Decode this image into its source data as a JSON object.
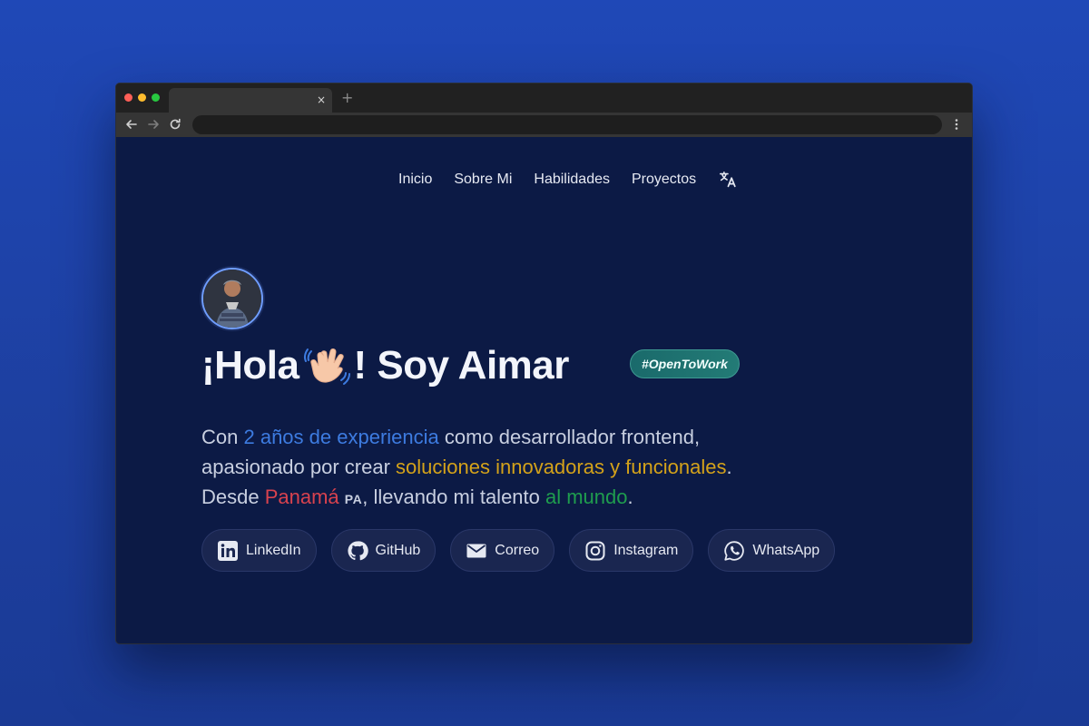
{
  "browser": {
    "tab_close": "×",
    "new_tab": "+"
  },
  "nav": {
    "items": [
      "Inicio",
      "Sobre Mi",
      "Habilidades",
      "Proyectos"
    ],
    "translate_icon": "translate-icon"
  },
  "hero": {
    "headline_start": "¡Hola",
    "headline_end": "! Soy Aimar",
    "badge": "#OpenToWork",
    "bio": {
      "line1_a": "Con ",
      "line1_hl": "2 años de experiencia",
      "line1_b": " como desarrollador frontend,",
      "line2_a": "apasionado por crear ",
      "line2_hl": "soluciones innovadoras y funcionales",
      "line2_b": ".",
      "line3_a": "Desde ",
      "line3_hl": "Panamá",
      "line3_code": "PA",
      "line3_b": ", llevando mi talento ",
      "line3_hl2": "al mundo",
      "line3_c": "."
    }
  },
  "socials": [
    {
      "label": "LinkedIn",
      "icon": "linkedin-icon"
    },
    {
      "label": "GitHub",
      "icon": "github-icon"
    },
    {
      "label": "Correo",
      "icon": "mail-icon"
    },
    {
      "label": "Instagram",
      "icon": "instagram-icon"
    },
    {
      "label": "WhatsApp",
      "icon": "whatsapp-icon"
    }
  ],
  "colors": {
    "background": "#1f48b7",
    "page": "#0c1a45",
    "accent_blue": "#3d7be0",
    "accent_gold": "#d4a21a",
    "accent_red": "#d8424e",
    "accent_green": "#1f9d4e",
    "badge": "#237b76"
  }
}
